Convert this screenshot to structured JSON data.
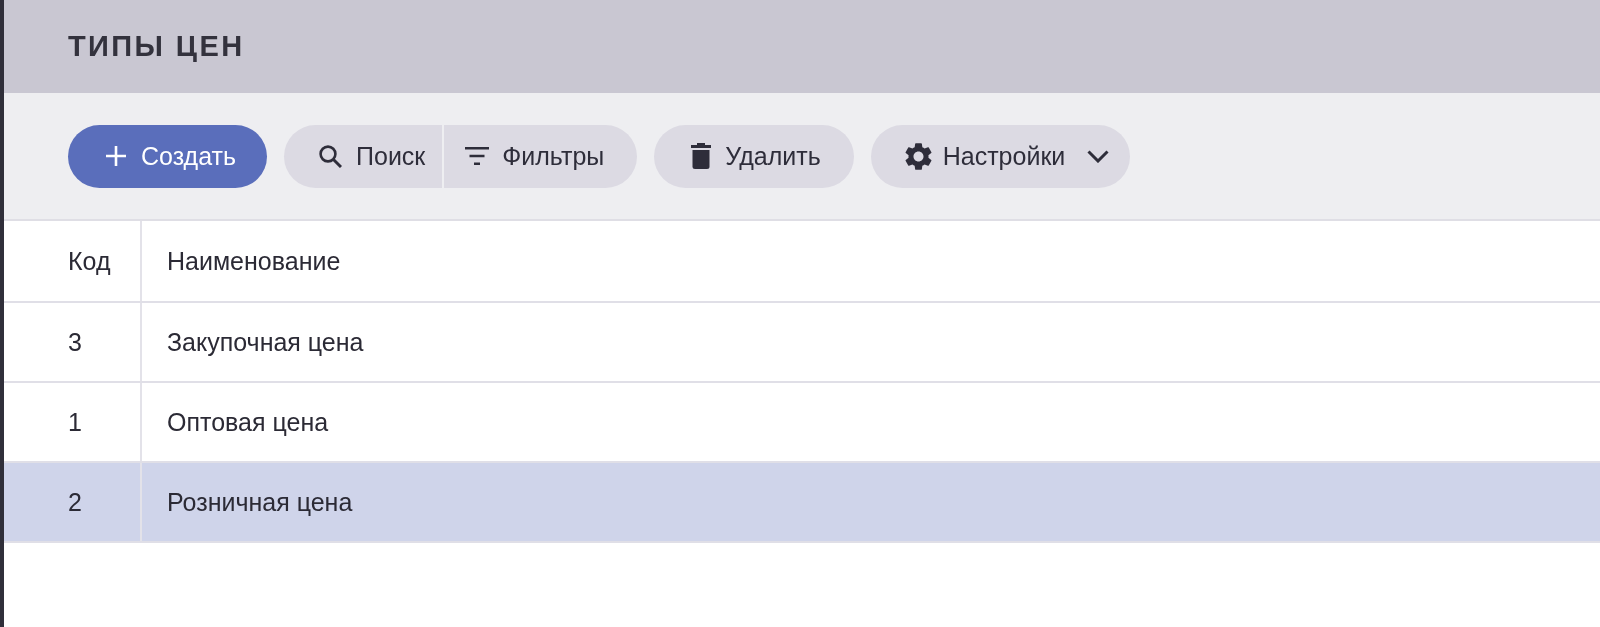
{
  "header": {
    "title": "ТИПЫ ЦЕН"
  },
  "toolbar": {
    "create_button": {
      "label": "Создать"
    },
    "search_button": {
      "label": "Поиск"
    },
    "filter_button": {
      "label": "Фильтры"
    },
    "delete_button": {
      "label": "Удалить"
    },
    "settings_button": {
      "label": "Настройки"
    }
  },
  "table": {
    "columns": [
      "Код",
      "Наименование"
    ],
    "rows": [
      {
        "code": "3",
        "name": "Закупочная цена",
        "selected": false
      },
      {
        "code": "1",
        "name": "Оптовая цена",
        "selected": false
      },
      {
        "code": "2",
        "name": "Розничная цена",
        "selected": true
      }
    ]
  }
}
